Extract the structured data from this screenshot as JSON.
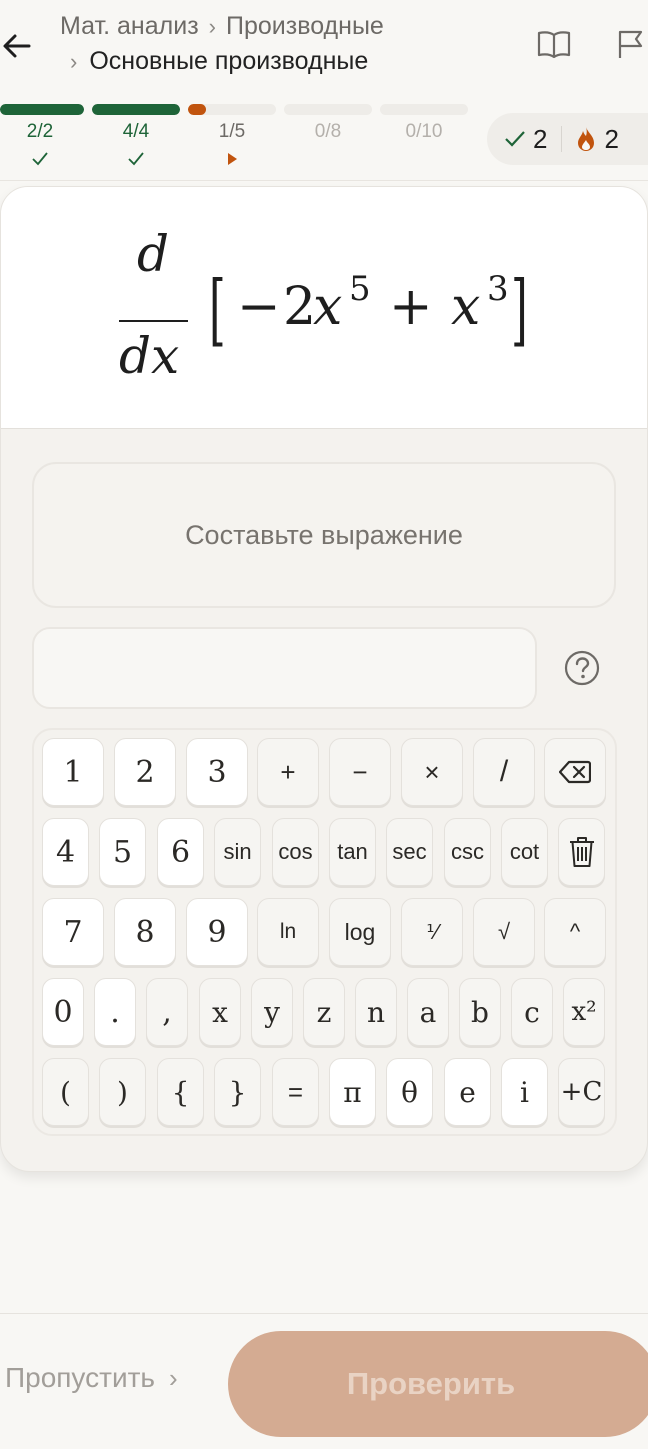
{
  "header": {
    "breadcrumb_parent": "Мат. анализ",
    "breadcrumb_section": "Производные",
    "breadcrumb_current": "Основные производные",
    "icons": [
      "back-arrow-icon",
      "book-icon",
      "flag-icon"
    ]
  },
  "progress": {
    "segments": [
      {
        "label": "2/2",
        "fraction": 1.0,
        "status": "done"
      },
      {
        "label": "4/4",
        "fraction": 1.0,
        "status": "done"
      },
      {
        "label": "1/5",
        "fraction": 0.2,
        "status": "current"
      },
      {
        "label": "0/8",
        "fraction": 0.0,
        "status": "pending"
      },
      {
        "label": "0/10",
        "fraction": 0.0,
        "status": "pending"
      }
    ],
    "correct_count": "2",
    "streak_count": "2"
  },
  "problem": {
    "operator_numerator": "d",
    "operator_denominator": "dx",
    "bracket_open": "[",
    "bracket_close": "]",
    "term1_sign": "−",
    "term1_coef": "2",
    "term1_var": "x",
    "term1_exp": "5",
    "plus": "+",
    "term2_var": "x",
    "term2_exp": "3"
  },
  "prompt": "Составьте выражение",
  "answer_value": "",
  "keypad": {
    "row1": [
      "1",
      "2",
      "3",
      "+",
      "−",
      "×",
      "/"
    ],
    "row2": [
      "4",
      "5",
      "6",
      "sin",
      "cos",
      "tan",
      "sec",
      "csc",
      "cot"
    ],
    "row3": [
      "7",
      "8",
      "9",
      "ln",
      "log",
      "⅟",
      "√",
      "^"
    ],
    "row4": [
      "0",
      ".",
      ",",
      "x",
      "y",
      "z",
      "n",
      "a",
      "b",
      "c",
      "x²"
    ],
    "row5": [
      "(",
      ")",
      "{",
      "}",
      "=",
      "π",
      "θ",
      "e",
      "i",
      "+C"
    ]
  },
  "footer": {
    "skip_label": "Пропустить",
    "check_label": "Проверить"
  },
  "colors": {
    "done": "#1e6438",
    "current": "#c1540e",
    "pending": "#eeece8",
    "check_button": "#d4ab92",
    "streak": "#c1540e"
  }
}
